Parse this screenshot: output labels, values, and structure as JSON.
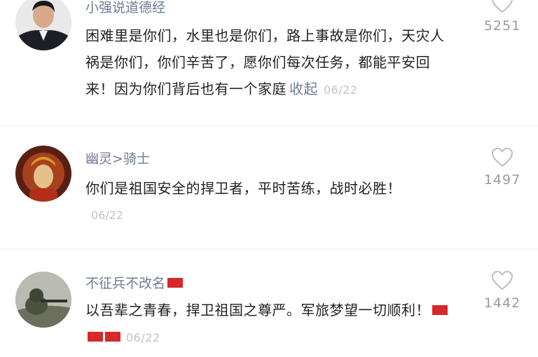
{
  "comments": [
    {
      "username": "小强说道德经",
      "text": "困难里是你们，水里也是你们，路上事故是你们，天灾人祸是你们，你们辛苦了，愿你们每次任务，都能平安回来！因为你们背后也有一个家庭",
      "collapse_label": "收起",
      "date": "06/22",
      "likes": "5251"
    },
    {
      "username": "幽灵>骑士",
      "text": "你们是祖国安全的捍卫者，平时苦练，战时必胜！",
      "date": "06/22",
      "likes": "1497"
    },
    {
      "username": "不征兵不改名",
      "text": "以吾辈之青春，捍卫祖国之尊严。军旅梦望一切顺利！",
      "date": "06/22",
      "likes": "1442"
    }
  ],
  "icons": {
    "like": "heart-outline-icon",
    "flag": "red-flag-emoji"
  },
  "colors": {
    "username": "#6f7a95",
    "date": "#c3c3c3",
    "count": "#9a9a9a",
    "flag": "#d62a2a"
  }
}
